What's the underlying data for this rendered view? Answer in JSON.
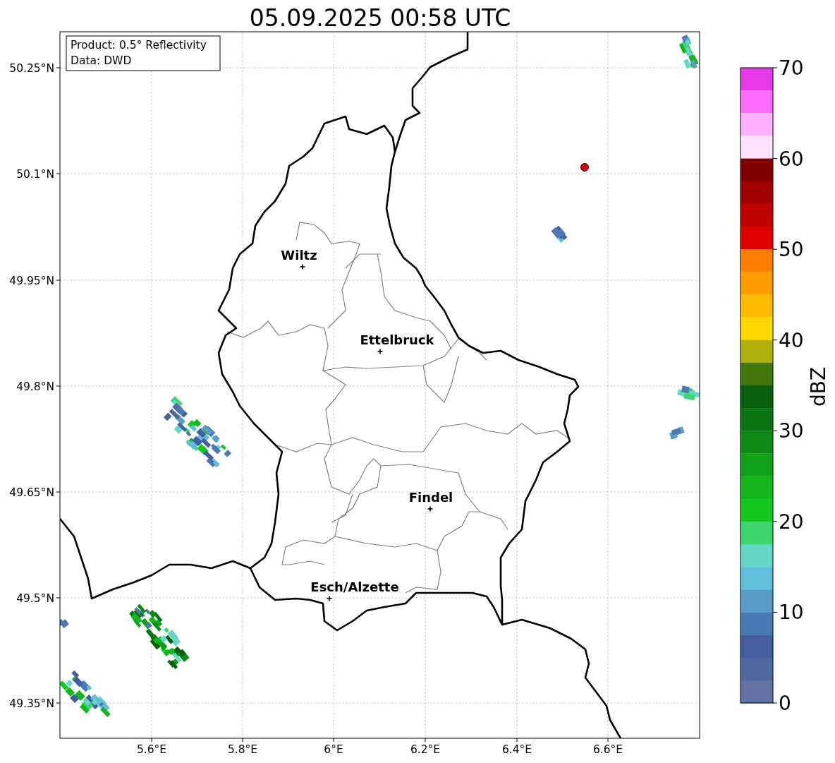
{
  "title": "05.09.2025 00:58 UTC",
  "info_box": [
    "Product: 0.5° Reflectivity",
    "Data: DWD"
  ],
  "cities": [
    {
      "name": "Wiltz"
    },
    {
      "name": "Ettelbruck"
    },
    {
      "name": "Findel"
    },
    {
      "name": "Esch/Alzette"
    }
  ],
  "x_tick_labels": [
    "5.6°E",
    "5.8°E",
    "6°E",
    "6.2°E",
    "6.4°E",
    "6.6°E"
  ],
  "y_tick_labels": [
    "50.25°N",
    "50.1°N",
    "49.95°N",
    "49.8°N",
    "49.65°N",
    "49.5°N",
    "49.35°N"
  ],
  "colorbar": {
    "label": "dBZ",
    "ticks": [
      "70",
      "60",
      "50",
      "40",
      "30",
      "20",
      "10",
      "0"
    ],
    "bins": [
      {
        "color": "#e83ae8"
      },
      {
        "color": "#ff6cff"
      },
      {
        "color": "#ffb0ff"
      },
      {
        "color": "#ffe0ff"
      },
      {
        "color": "#800000"
      },
      {
        "color": "#a00000"
      },
      {
        "color": "#c00000"
      },
      {
        "color": "#e00000"
      },
      {
        "color": "#ff7d00"
      },
      {
        "color": "#ff9c00"
      },
      {
        "color": "#ffbb00"
      },
      {
        "color": "#ffd700"
      },
      {
        "color": "#b0b00a"
      },
      {
        "color": "#45780c"
      },
      {
        "color": "#08600e"
      },
      {
        "color": "#0a7512"
      },
      {
        "color": "#0e8a16"
      },
      {
        "color": "#10a018"
      },
      {
        "color": "#12b71c"
      },
      {
        "color": "#13c81e"
      },
      {
        "color": "#3dd66e"
      },
      {
        "color": "#63d6c8"
      },
      {
        "color": "#63bedc"
      },
      {
        "color": "#5a9cc8"
      },
      {
        "color": "#4a7ab5"
      },
      {
        "color": "#445ea0"
      },
      {
        "color": "#5068a0"
      },
      {
        "color": "#6272a5"
      }
    ]
  }
}
